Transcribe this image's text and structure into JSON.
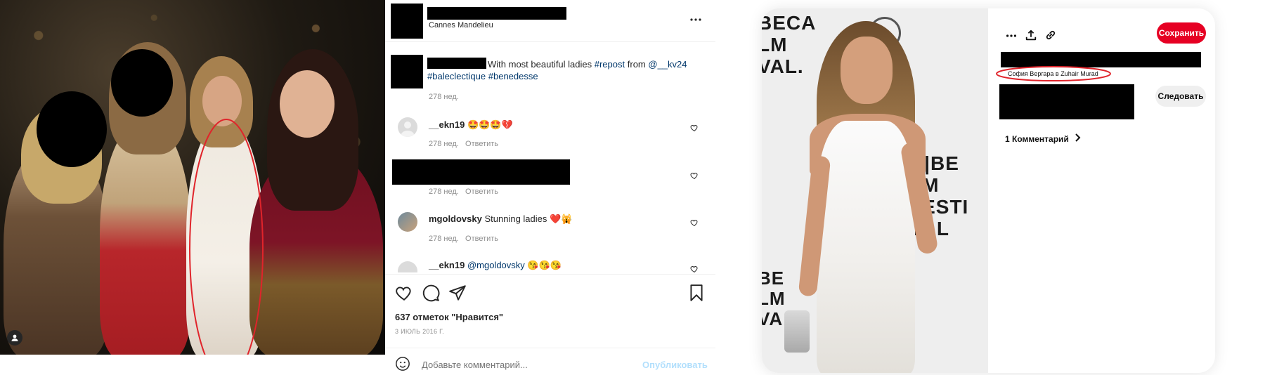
{
  "instagram": {
    "location": "Cannes Mandelieu",
    "caption": {
      "text": "With most beautiful ladies",
      "hashtag_repost": "#repost",
      "from_word": "from",
      "mention": "@__kv24",
      "hashtag_1": "#baleclectique",
      "hashtag_2": "#benedesse",
      "time": "278 нед."
    },
    "comments": [
      {
        "user": "__ekn19",
        "text": "🤩🤩🤩💔",
        "time": "278 нед.",
        "reply": "Ответить"
      },
      {
        "user": "",
        "text": "",
        "time": "278 нед.",
        "reply": "Ответить"
      },
      {
        "user": "mgoldovsky",
        "text": "Stunning ladies ❤️🙀",
        "time": "278 нед.",
        "reply": "Ответить"
      },
      {
        "user": "__ekn19",
        "mention": "@mgoldovsky",
        "text": "😘😘😘"
      }
    ],
    "likes": "637 отметок \"Нравится\"",
    "date": "3 ИЮЛЬ 2016 Г.",
    "comment_placeholder": "Добавьте комментарий...",
    "publish_label": "Опубликовать",
    "icons": [
      "more-icon",
      "heart-icon",
      "comment-icon",
      "share-icon",
      "bookmark-icon",
      "emoji-icon",
      "user-icon"
    ]
  },
  "pinterest": {
    "save_label": "Сохранить",
    "pin_description": "София Вергара в Zuhair Murad",
    "follow_label": "Следовать",
    "comments_label": "1 Комментарий",
    "backdrop": {
      "line1": "BECA",
      "line2": "LM",
      "line3": "VAL.",
      "right1": "R|BE",
      "right2": "LM",
      "right3": "FESTI",
      "right4": "VAL",
      "bottom1": "BE",
      "bottom2": "LM",
      "bottom3": "VA"
    },
    "icons": [
      "more-icon",
      "upload-icon",
      "link-icon",
      "chevron-right-icon"
    ]
  },
  "colors": {
    "annotation_red": "#e0242b",
    "pinterest_red": "#e60023",
    "instagram_link": "#00376b",
    "publish_blue": "#b2dffc"
  }
}
